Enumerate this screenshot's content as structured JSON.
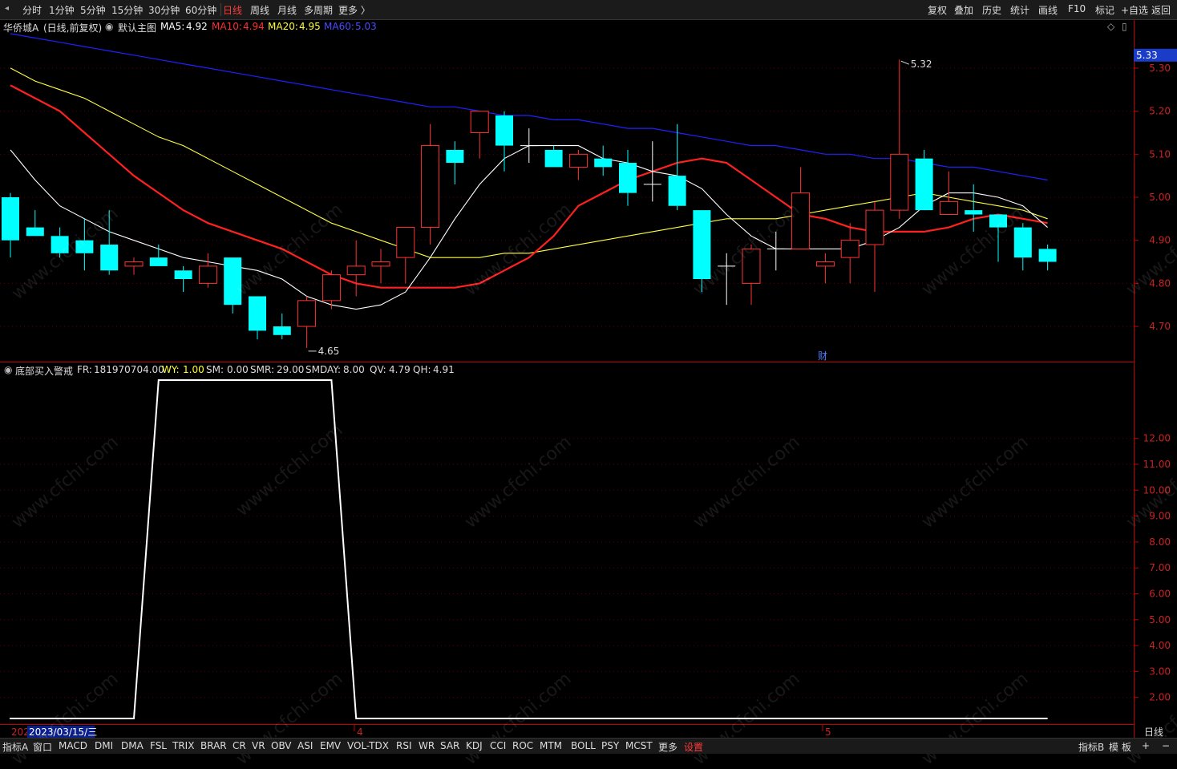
{
  "toolbar": {
    "periods": [
      "分时",
      "1分钟",
      "5分钟",
      "15分钟",
      "30分钟",
      "60分钟",
      "日线",
      "周线",
      "月线",
      "多周期",
      "更多 〉"
    ],
    "active_period": "日线",
    "right_buttons": [
      "复权",
      "叠加",
      "历史",
      "统计",
      "画线",
      "F10",
      "标记",
      "+自选",
      "返回"
    ]
  },
  "main_panel": {
    "stock_name": "华侨城A",
    "mode": "(日线,前复权)",
    "template": "默认主图",
    "ma5": {
      "label": "MA5:",
      "value": "4.92",
      "color": "#ffffff"
    },
    "ma10": {
      "label": "MA10:",
      "value": "4.94",
      "color": "#ff3030"
    },
    "ma20": {
      "label": "MA20:",
      "value": "4.95",
      "color": "#ffff33"
    },
    "ma60": {
      "label": "MA60:",
      "value": "5.03",
      "color": "#3232ff"
    },
    "current_price_tag": "5.33",
    "high_marker": "5.32",
    "low_marker": "4.65",
    "event_marker": "财",
    "price_ticks": [
      "5.30",
      "5.20",
      "5.10",
      "5.00",
      "4.90",
      "4.80",
      "4.70"
    ]
  },
  "sub_panel": {
    "indicator_name": "底部买入警戒",
    "fr": {
      "label": "FR:",
      "value": "181970704.00"
    },
    "wy": {
      "label": "WY:",
      "value": "1.00"
    },
    "sm": {
      "label": "SM:",
      "value": "0.00"
    },
    "smr": {
      "label": "SMR:",
      "value": "29.00"
    },
    "smday": {
      "label": "SMDAY:",
      "value": "8.00"
    },
    "qv": {
      "label": "QV:",
      "value": "4.79"
    },
    "qh": {
      "label": "QH:",
      "value": "4.91"
    },
    "ticks": [
      "12.00",
      "11.00",
      "10.00",
      "9.00",
      "8.00",
      "7.00",
      "6.00",
      "5.00",
      "4.00",
      "3.00",
      "2.00"
    ]
  },
  "x_axis": {
    "cursor_date": "2023/03/15/三",
    "year_prefix": "202",
    "month_marks": [
      "4",
      "5"
    ],
    "period_label": "日线"
  },
  "bottom_bar": {
    "left_tab": "指标A",
    "items": [
      "窗口",
      "MACD",
      "DMI",
      "DMA",
      "FSL",
      "TRIX",
      "BRAR",
      "CR",
      "VR",
      "OBV",
      "ASI",
      "EMV",
      "VOL-TDX",
      "RSI",
      "WR",
      "SAR",
      "KDJ",
      "CCI",
      "ROC",
      "MTM",
      "BOLL",
      "PSY",
      "MCST",
      "更多",
      "设置"
    ],
    "active_item": "设置",
    "right_items": [
      "指标B",
      "模",
      "板",
      "+",
      "−"
    ]
  },
  "watermark": "www.cfchi.com",
  "colors": {
    "up": "#ff3232",
    "down": "#00ffff",
    "ma5": "#ffffff",
    "ma10": "#ff2020",
    "ma20": "#ffff40",
    "ma60": "#2020ff",
    "axis": "#c00000"
  },
  "chart_data": {
    "type": "candlestick",
    "candles": [
      {
        "o": 5.0,
        "h": 5.01,
        "l": 4.86,
        "c": 4.9
      },
      {
        "o": 4.93,
        "h": 4.97,
        "l": 4.91,
        "c": 4.91
      },
      {
        "o": 4.91,
        "h": 4.93,
        "l": 4.86,
        "c": 4.87
      },
      {
        "o": 4.9,
        "h": 4.95,
        "l": 4.83,
        "c": 4.87
      },
      {
        "o": 4.89,
        "h": 4.97,
        "l": 4.82,
        "c": 4.83
      },
      {
        "o": 4.84,
        "h": 4.86,
        "l": 4.82,
        "c": 4.85
      },
      {
        "o": 4.86,
        "h": 4.89,
        "l": 4.84,
        "c": 4.84
      },
      {
        "o": 4.83,
        "h": 4.84,
        "l": 4.78,
        "c": 4.81
      },
      {
        "o": 4.8,
        "h": 4.87,
        "l": 4.79,
        "c": 4.84
      },
      {
        "o": 4.86,
        "h": 4.86,
        "l": 4.73,
        "c": 4.75
      },
      {
        "o": 4.77,
        "h": 4.77,
        "l": 4.67,
        "c": 4.69
      },
      {
        "o": 4.7,
        "h": 4.73,
        "l": 4.67,
        "c": 4.68
      },
      {
        "o": 4.7,
        "h": 4.77,
        "l": 4.65,
        "c": 4.76
      },
      {
        "o": 4.76,
        "h": 4.83,
        "l": 4.74,
        "c": 4.82
      },
      {
        "o": 4.82,
        "h": 4.9,
        "l": 4.77,
        "c": 4.84
      },
      {
        "o": 4.84,
        "h": 4.88,
        "l": 4.8,
        "c": 4.85
      },
      {
        "o": 4.86,
        "h": 4.93,
        "l": 4.8,
        "c": 4.93
      },
      {
        "o": 4.93,
        "h": 5.17,
        "l": 4.89,
        "c": 5.12
      },
      {
        "o": 5.11,
        "h": 5.13,
        "l": 5.03,
        "c": 5.08
      },
      {
        "o": 5.15,
        "h": 5.2,
        "l": 5.09,
        "c": 5.2
      },
      {
        "o": 5.19,
        "h": 5.2,
        "l": 5.06,
        "c": 5.12
      },
      {
        "o": 5.12,
        "h": 5.16,
        "l": 5.08,
        "c": 5.12
      },
      {
        "o": 5.11,
        "h": 5.12,
        "l": 5.07,
        "c": 5.07
      },
      {
        "o": 5.07,
        "h": 5.11,
        "l": 5.04,
        "c": 5.1
      },
      {
        "o": 5.09,
        "h": 5.12,
        "l": 5.05,
        "c": 5.07
      },
      {
        "o": 5.08,
        "h": 5.11,
        "l": 4.98,
        "c": 5.01
      },
      {
        "o": 5.03,
        "h": 5.13,
        "l": 4.99,
        "c": 5.03
      },
      {
        "o": 5.05,
        "h": 5.17,
        "l": 4.97,
        "c": 4.98
      },
      {
        "o": 4.97,
        "h": 4.97,
        "l": 4.78,
        "c": 4.81
      },
      {
        "o": 4.84,
        "h": 4.87,
        "l": 4.75,
        "c": 4.84
      },
      {
        "o": 4.8,
        "h": 4.89,
        "l": 4.75,
        "c": 4.88
      },
      {
        "o": 4.88,
        "h": 4.92,
        "l": 4.83,
        "c": 4.88
      },
      {
        "o": 4.88,
        "h": 5.07,
        "l": 4.88,
        "c": 5.01
      },
      {
        "o": 4.84,
        "h": 4.87,
        "l": 4.8,
        "c": 4.85
      },
      {
        "o": 4.86,
        "h": 4.94,
        "l": 4.8,
        "c": 4.9
      },
      {
        "o": 4.89,
        "h": 4.99,
        "l": 4.78,
        "c": 4.97
      },
      {
        "o": 4.97,
        "h": 5.32,
        "l": 4.95,
        "c": 5.1
      },
      {
        "o": 5.09,
        "h": 5.11,
        "l": 4.97,
        "c": 4.97
      },
      {
        "o": 4.96,
        "h": 5.06,
        "l": 4.96,
        "c": 4.99
      },
      {
        "o": 4.97,
        "h": 5.03,
        "l": 4.92,
        "c": 4.96
      },
      {
        "o": 4.96,
        "h": 4.96,
        "l": 4.85,
        "c": 4.93
      },
      {
        "o": 4.93,
        "h": 4.94,
        "l": 4.83,
        "c": 4.86
      },
      {
        "o": 4.88,
        "h": 4.89,
        "l": 4.83,
        "c": 4.85
      }
    ],
    "ma5": [
      5.11,
      5.04,
      4.98,
      4.95,
      4.92,
      4.9,
      4.88,
      4.86,
      4.85,
      4.84,
      4.83,
      4.81,
      4.77,
      4.75,
      4.74,
      4.75,
      4.78,
      4.86,
      4.95,
      5.03,
      5.09,
      5.12,
      5.12,
      5.12,
      5.09,
      5.08,
      5.06,
      5.05,
      5.02,
      4.96,
      4.91,
      4.88,
      4.88,
      4.88,
      4.88,
      4.9,
      4.93,
      4.98,
      5.01,
      5.01,
      5.0,
      4.98,
      4.93
    ],
    "ma10": [
      5.26,
      5.23,
      5.2,
      5.15,
      5.1,
      5.05,
      5.01,
      4.97,
      4.94,
      4.92,
      4.9,
      4.88,
      4.85,
      4.82,
      4.8,
      4.79,
      4.79,
      4.79,
      4.79,
      4.8,
      4.83,
      4.86,
      4.91,
      4.98,
      5.01,
      5.04,
      5.06,
      5.08,
      5.09,
      5.08,
      5.04,
      5.0,
      4.96,
      4.95,
      4.93,
      4.92,
      4.92,
      4.92,
      4.93,
      4.95,
      4.96,
      4.95,
      4.94
    ],
    "ma20": [
      5.3,
      5.27,
      5.25,
      5.23,
      5.2,
      5.17,
      5.14,
      5.12,
      5.09,
      5.06,
      5.03,
      5.0,
      4.97,
      4.94,
      4.92,
      4.9,
      4.88,
      4.86,
      4.86,
      4.86,
      4.87,
      4.87,
      4.88,
      4.89,
      4.9,
      4.91,
      4.92,
      4.93,
      4.94,
      4.95,
      4.95,
      4.95,
      4.96,
      4.97,
      4.98,
      4.99,
      5.0,
      5.01,
      5.0,
      4.99,
      4.98,
      4.97,
      4.95
    ],
    "ma60": [
      5.38,
      5.37,
      5.36,
      5.35,
      5.34,
      5.33,
      5.32,
      5.31,
      5.3,
      5.29,
      5.28,
      5.27,
      5.26,
      5.25,
      5.24,
      5.23,
      5.22,
      5.21,
      5.21,
      5.2,
      5.19,
      5.19,
      5.18,
      5.18,
      5.17,
      5.16,
      5.16,
      5.15,
      5.14,
      5.13,
      5.12,
      5.12,
      5.11,
      5.1,
      5.1,
      5.09,
      5.09,
      5.08,
      5.07,
      5.07,
      5.06,
      5.05,
      5.04
    ],
    "price_range": [
      4.62,
      5.38
    ],
    "indicator": {
      "name": "底部买入警戒",
      "range": [
        0,
        13
      ],
      "points": [
        [
          0,
          0
        ],
        [
          5,
          0
        ],
        [
          6,
          13
        ],
        [
          13,
          13
        ],
        [
          14,
          0
        ],
        [
          42,
          0
        ]
      ]
    }
  }
}
